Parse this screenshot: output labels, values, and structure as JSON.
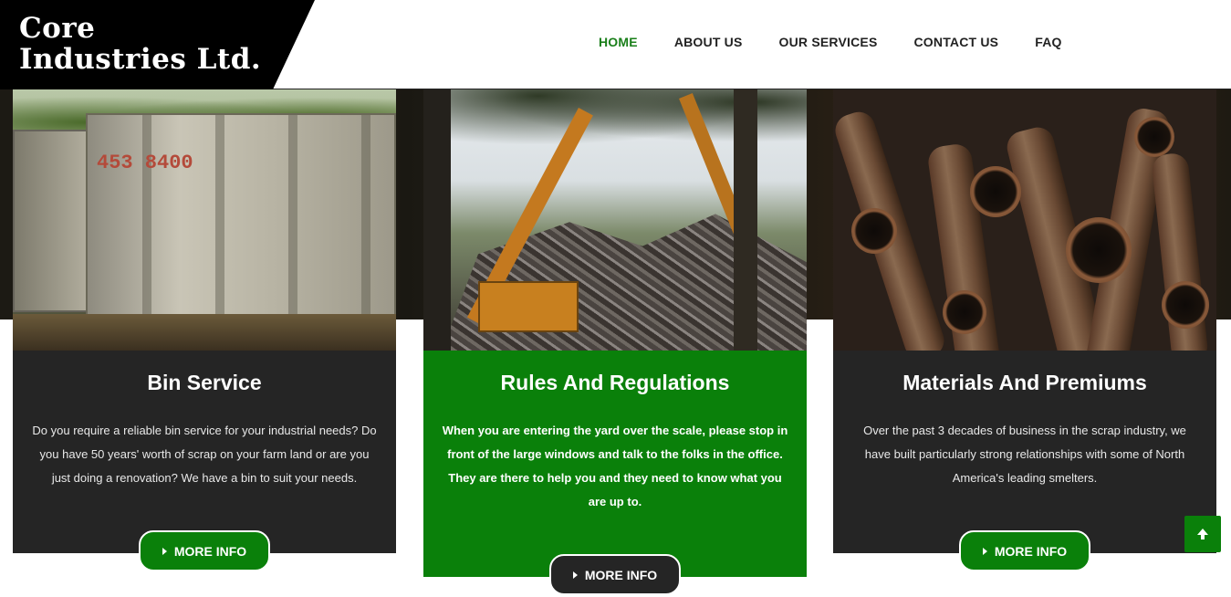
{
  "header": {
    "logo_line1": "Core",
    "logo_line2": "Industries Ltd.",
    "nav": [
      {
        "label": "HOME",
        "active": true
      },
      {
        "label": "ABOUT US",
        "active": false
      },
      {
        "label": "OUR SERVICES",
        "active": false
      },
      {
        "label": "CONTACT US",
        "active": false
      },
      {
        "label": "FAQ",
        "active": false
      }
    ]
  },
  "cards": [
    {
      "title": "Bin Service",
      "text": "Do you require a reliable bin service for your industrial needs? Do you have 50 years' worth of scrap on your farm land or are you just doing a renovation? We have a bin to suit your needs.",
      "button": "MORE INFO",
      "bin_paint": "453 8400"
    },
    {
      "title": "Rules And Regulations",
      "text": "When you are entering the yard over the scale, please stop in front of the large windows and talk to the folks in the office. They are there to help you and they need to know what you are up to.",
      "button": "MORE INFO"
    },
    {
      "title": "Materials And Premiums",
      "text": "Over the past 3 decades of business in the scrap industry, we have built particularly strong relationships with some of North America's leading smelters.",
      "button": "MORE INFO"
    }
  ],
  "colors": {
    "brand_green": "#0a800a",
    "dark_card": "#252525",
    "nav_active": "#1a7f1a"
  },
  "icons": {
    "scroll_top": "arrow-up-icon",
    "button_caret": "caret-right-icon"
  }
}
